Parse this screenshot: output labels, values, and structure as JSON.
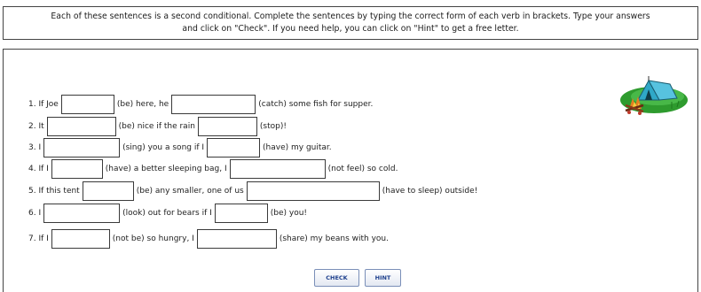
{
  "instructions": {
    "line1": "Each of these sentences is a second conditional. Complete the sentences by typing the correct form of each verb in brackets. Type your answers",
    "line2": "and click on \"Check\". If you need help, you can click on \"Hint\" to get a free letter."
  },
  "sentences": [
    {
      "p1": "1. If Joe",
      "p2": "(be) here, he",
      "p3": "(catch) some fish for supper."
    },
    {
      "p1": "2. It",
      "p2": "(be) nice if the rain",
      "p3": "(stop)!"
    },
    {
      "p1": "3. I",
      "p2": "(sing) you a song if I",
      "p3": "(have) my guitar."
    },
    {
      "p1": "4. If I",
      "p2": "(have) a better sleeping bag, I",
      "p3": "(not feel) so cold."
    },
    {
      "p1": "5. If this tent",
      "p2": "(be) any smaller, one of us",
      "p3": "(have to sleep) outside!"
    },
    {
      "p1": "6. I",
      "p2": "(look) out for bears if I",
      "p3": "(be) you!"
    },
    {
      "p1": "7. If I",
      "p2": "(not be) so hungry, I",
      "p3": "(share) my beans with you."
    }
  ],
  "buttons": {
    "check": "CHECK",
    "hint": "HINT"
  },
  "colors": {
    "tent": "#2fa8c8",
    "grass": "#2e9b2e",
    "fire": "#c0392b",
    "button_text": "#1d3f8c"
  },
  "icons": {
    "illustration": "campsite-tent-fire-icon"
  }
}
